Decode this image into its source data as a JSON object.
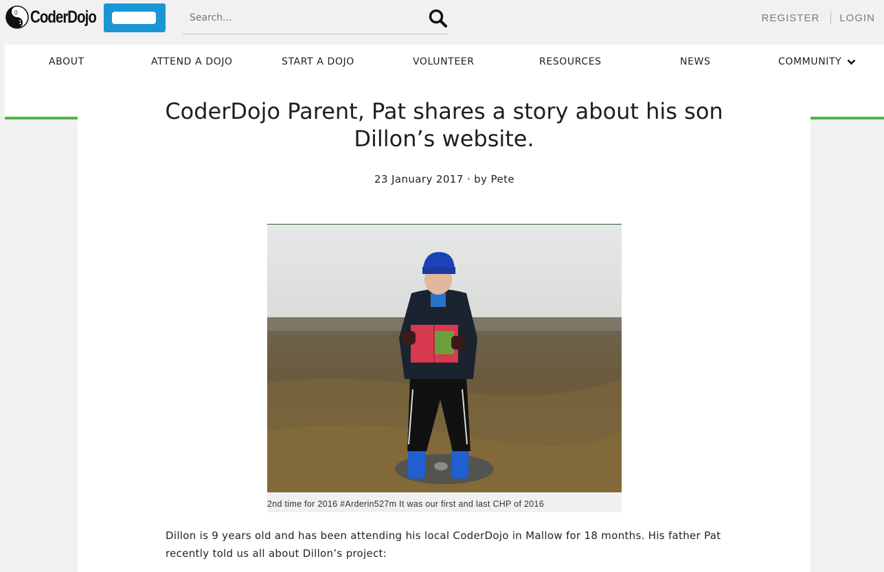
{
  "brand": {
    "name": "CoderDojo",
    "accent": "#1a96d4",
    "green": "#4cb748"
  },
  "search": {
    "placeholder": "Search...",
    "icon": "search-icon"
  },
  "auth": {
    "register": "REGISTER",
    "login": "LOGIN"
  },
  "nav": {
    "items": [
      "ABOUT",
      "ATTEND A DOJO",
      "START A DOJO",
      "VOLUNTEER",
      "RESOURCES",
      "NEWS",
      "COMMUNITY"
    ],
    "dropdown_icon": "chevron-down-icon"
  },
  "article": {
    "title": "CoderDojo Parent, Pat shares a story about his son Dillon’s website.",
    "meta": "23 January 2017 · by Pete",
    "caption": "2nd time for 2016 #Arderin527m It was our first and last CHP of 2016",
    "paragraph": "Dillon is 9 years old and has been attending his local CoderDojo in Mallow for 18 months. His father Pat recently told us all about Dillon’s project:"
  }
}
